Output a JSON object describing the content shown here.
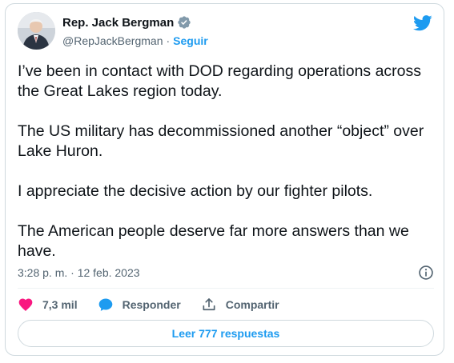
{
  "author": {
    "name": "Rep. Jack Bergman",
    "handle": "@RepJackBergman",
    "separator": "·",
    "follow_label": "Seguir"
  },
  "tweet": {
    "paragraphs": [
      "I’ve been in contact with DOD regarding operations across the Great Lakes region today.",
      "The US military has decommissioned another “object” over Lake Huron.",
      "I appreciate the decisive action by our fighter pilots.",
      "The American people deserve far more answers than we have."
    ],
    "timestamp": "3:28 p. m. · 12 feb. 2023"
  },
  "actions": {
    "likes_count": "7,3 mil",
    "reply_label": "Responder",
    "share_label": "Compartir"
  },
  "replies_button_label": "Leer 777 respuestas",
  "icons": {
    "brand": "twitter-bird-icon",
    "verified": "verified-badge-icon",
    "info": "info-icon",
    "like": "heart-icon",
    "reply": "speech-bubble-icon",
    "share": "share-upload-icon"
  },
  "colors": {
    "accent": "#1d9bf0",
    "like": "#f91880",
    "text": "#0f1419",
    "muted": "#536471",
    "border": "#cfd9de"
  }
}
